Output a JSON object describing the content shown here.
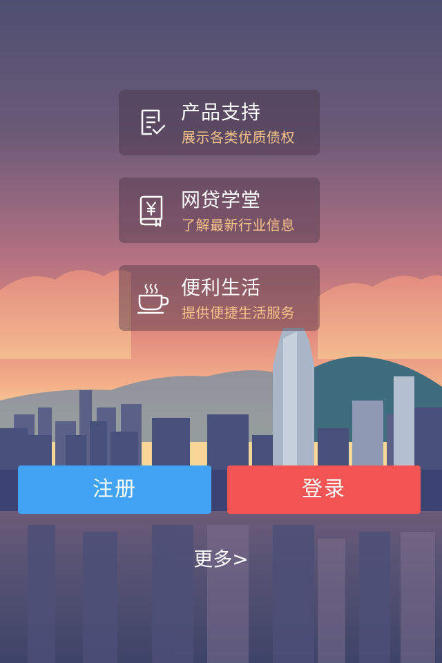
{
  "cards": [
    {
      "title": "产品支持",
      "subtitle": "展示各类优质债权",
      "icon": "document-check-icon"
    },
    {
      "title": "网贷学堂",
      "subtitle": "了解最新行业信息",
      "icon": "yuan-book-icon"
    },
    {
      "title": "便利生活",
      "subtitle": "提供便捷生活服务",
      "icon": "coffee-cup-icon"
    }
  ],
  "buttons": {
    "register": "注册",
    "login": "登录"
  },
  "more_link": "更多>",
  "colors": {
    "register": "#42a2f3",
    "login": "#f25553",
    "subtitle": "#f6c38a"
  }
}
